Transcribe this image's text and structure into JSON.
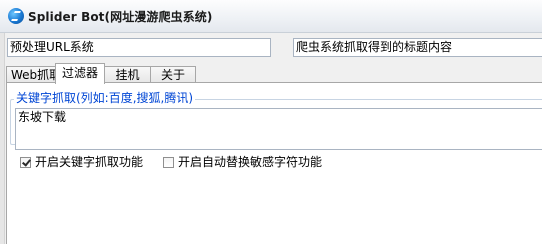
{
  "window": {
    "title": "Splider Bot(网址漫游爬虫系统)",
    "icon": "app-logo-icon"
  },
  "fields": {
    "url_preprocess": {
      "value": "预处理URL系统"
    },
    "crawled_title": {
      "value": "爬虫系统抓取得到的标题内容"
    }
  },
  "tabs": [
    {
      "label": "Web抓取",
      "active": false
    },
    {
      "label": "过滤器",
      "active": true
    },
    {
      "label": "挂机",
      "active": false
    },
    {
      "label": "关于",
      "active": false
    }
  ],
  "filter_panel": {
    "group_label": "关键字抓取(列如:百度,搜狐,腾讯)",
    "keyword_input_value": "东坡下载",
    "checkbox_keyword_capture": {
      "label": "开启关键字抓取功能",
      "checked": true
    },
    "checkbox_auto_replace": {
      "label": "开启自动替换敏感字符功能",
      "checked": false
    }
  }
}
